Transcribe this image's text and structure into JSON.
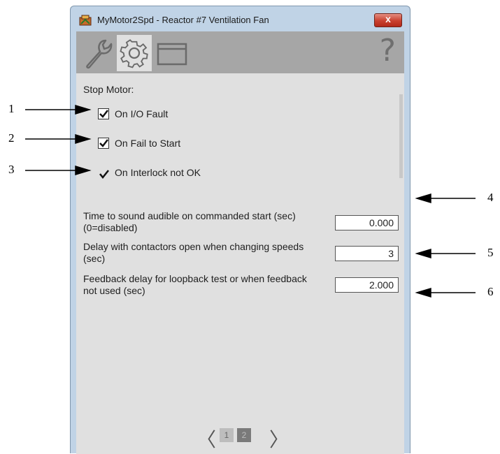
{
  "window": {
    "title": "MyMotor2Spd - Reactor #7 Ventilation Fan",
    "close_label": "x"
  },
  "toolbar": {
    "tabs": [
      {
        "name": "maintenance",
        "icon": "wrench-icon"
      },
      {
        "name": "configuration",
        "icon": "gear-icon",
        "active": true
      },
      {
        "name": "faceplate",
        "icon": "window-icon"
      }
    ],
    "help_label": "?"
  },
  "content": {
    "stop_motor_label": "Stop Motor:",
    "options": [
      {
        "label": "On I/O Fault",
        "checked": true
      },
      {
        "label": "On Fail to Start",
        "checked": true
      },
      {
        "label": "On Interlock not OK",
        "checked": true,
        "readonly": true
      }
    ],
    "fields": [
      {
        "label": "Time to sound audible on commanded start (sec) (0=disabled)",
        "value": "0.000"
      },
      {
        "label": "Delay with contactors open when changing speeds (sec)",
        "value": "3"
      },
      {
        "label": "Feedback delay for loopback test or when feedback not used (sec)",
        "value": "2.000"
      }
    ]
  },
  "pager": {
    "prev": "〈",
    "next": "〉",
    "pages": [
      "1",
      "2"
    ],
    "current": "2"
  },
  "callouts": [
    "1",
    "2",
    "3",
    "4",
    "5",
    "6"
  ]
}
